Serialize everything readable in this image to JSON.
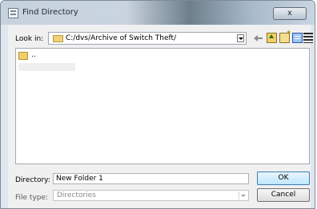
{
  "window": {
    "title": "Find Directory",
    "close_label": "x"
  },
  "toolbar": {
    "lookin_label": "Look in:",
    "lookin_path": "C:/dvs/Archive of Switch Theft/",
    "icons": [
      "back-icon",
      "up-folder-icon",
      "new-folder-icon",
      "detail-view-icon",
      "list-view-icon"
    ]
  },
  "files": {
    "items": [
      {
        "name": "..",
        "icon": "folder-icon"
      }
    ]
  },
  "form": {
    "directory_label": "Directory:",
    "directory_value": "New Folder 1",
    "filetype_label": "File type:",
    "filetype_value": "Directories"
  },
  "buttons": {
    "ok": "OK",
    "cancel": "Cancel"
  }
}
